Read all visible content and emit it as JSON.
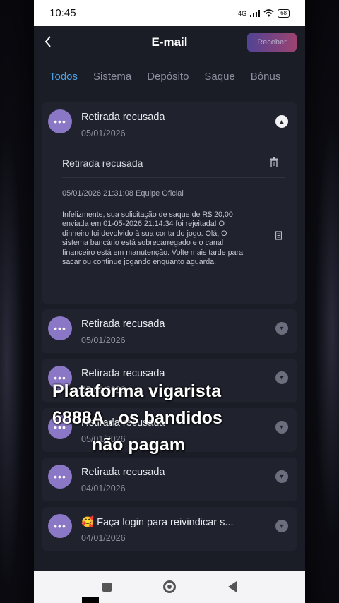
{
  "status_bar": {
    "time": "10:45",
    "network": "4G",
    "battery": "68"
  },
  "header": {
    "title": "E-mail",
    "back_icon": "chevron-left-icon",
    "receive_label": "Receber"
  },
  "tabs": [
    {
      "label": "Todos",
      "active": true
    },
    {
      "label": "Sistema",
      "active": false
    },
    {
      "label": "Depósito",
      "active": false
    },
    {
      "label": "Saque",
      "active": false
    },
    {
      "label": "Bônus",
      "active": false
    }
  ],
  "expanded_message": {
    "title": "Retirada recusada",
    "date": "05/01/2026",
    "detail_title": "Retirada recusada",
    "meta": "05/01/2026 21:31:08 Equipe Oficial",
    "body": "Infelizmente, sua solicitação de saque de R$ 20,00 enviada em 01-05-2026 21:14:34 foi rejeitada! O dinheiro foi devolvido à sua conta do jogo. Olá, O sistema bancário está sobrecarregado e o canal financeiro está em manutenção. Volte mais tarde para sacar ou continue jogando enquanto aguarda."
  },
  "messages": [
    {
      "title": "Retirada recusada",
      "date": "05/01/2026"
    },
    {
      "title": "Retirada recusada",
      "date": "05/01/2026"
    },
    {
      "title": "Retirada recusada",
      "date": "05/01/2026"
    },
    {
      "title": "Retirada recusada",
      "date": "04/01/2026"
    },
    {
      "title": "🥰 Faça login para reivindicar s...",
      "date": "04/01/2026"
    }
  ],
  "avatar_glyph": "•••",
  "overlay": {
    "line1": "Plataforma vigarista",
    "line2": "6888A , os bandidos",
    "line3": "não pagam"
  },
  "colors": {
    "accent_tab": "#4ba3e6",
    "avatar": "#8a78c6",
    "background": "#1a1c26",
    "card": "#20222d"
  }
}
